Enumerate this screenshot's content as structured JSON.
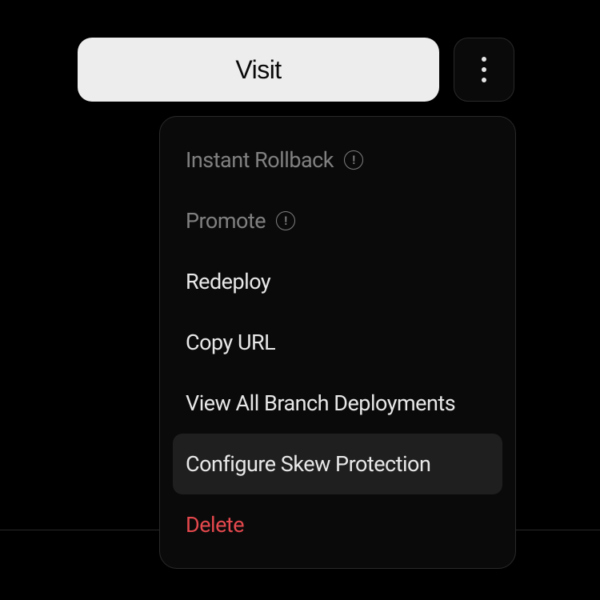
{
  "topBar": {
    "visit_label": "Visit"
  },
  "menu": {
    "items": [
      {
        "label": "Instant Rollback",
        "state": "disabled",
        "hasInfo": true
      },
      {
        "label": "Promote",
        "state": "disabled",
        "hasInfo": true
      },
      {
        "label": "Redeploy",
        "state": "normal",
        "hasInfo": false
      },
      {
        "label": "Copy URL",
        "state": "normal",
        "hasInfo": false
      },
      {
        "label": "View All Branch Deployments",
        "state": "normal",
        "hasInfo": false
      },
      {
        "label": "Configure Skew Protection",
        "state": "highlighted",
        "hasInfo": false
      },
      {
        "label": "Delete",
        "state": "danger",
        "hasInfo": false
      }
    ]
  }
}
